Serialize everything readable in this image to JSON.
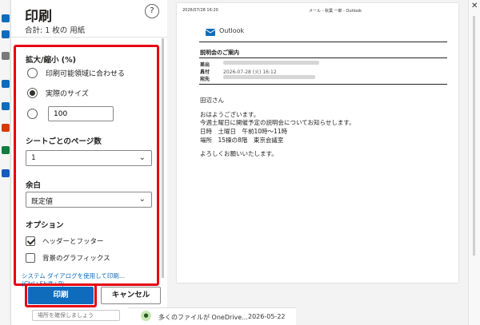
{
  "dialog": {
    "title": "印刷",
    "subtitle": "合計: 1 枚の 用紙",
    "help_label": "?",
    "scale": {
      "label": "拡大/縮小 (%)",
      "options": [
        "印刷可能領域に合わせる",
        "実際のサイズ"
      ],
      "custom_value": "100"
    },
    "pages_per_sheet": {
      "label": "シートごとのページ数",
      "value": "1"
    },
    "margins": {
      "label": "余白",
      "value": "既定値"
    },
    "options": {
      "label": "オプション",
      "header_footer": "ヘッダーとフッター",
      "background_graphics": "背景のグラフィックス"
    },
    "system_dialog_link": "システム ダイアログを使用して印刷... (Ctrl+Shift+P)",
    "print_button": "印刷",
    "cancel_button": "キャンセル"
  },
  "preview": {
    "header_date": "2026/07/28 16:20",
    "header_title": "メール - 秋葉 一郎 - Outlook",
    "app_name": "Outlook",
    "subject": "説明会のご案内",
    "meta": [
      {
        "key": "差出人",
        "value": ""
      },
      {
        "key": "日付",
        "value": "2026-07-28 (火) 16:12"
      },
      {
        "key": "宛先",
        "value": ""
      }
    ],
    "greeting": "田辺さん",
    "lines": [
      "おはようございます。",
      "今週土曜日に開催予定の説明会についてお知らせします。",
      "日時　土曜日　午前10時～11時",
      "場所　15棟の8階　東京会議室"
    ],
    "closing": "よろしくお願いいたします。"
  },
  "background": {
    "notify_text": "多くのファイルが OneDrive...",
    "notify_date": "2026-05-22",
    "left_text": "場所を確保しましょう"
  },
  "colors": {
    "accent": "#0f6cbd",
    "highlight": "#e60012"
  }
}
